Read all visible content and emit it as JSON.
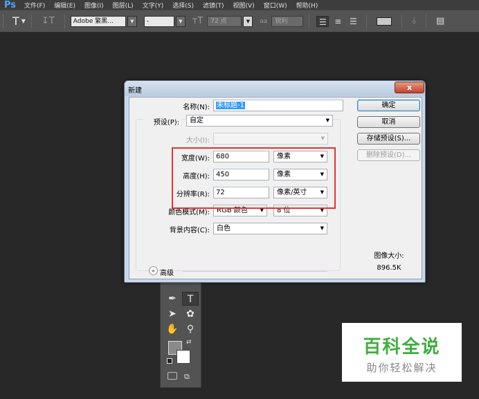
{
  "app": {
    "logo": "Ps"
  },
  "menu": [
    "文件(F)",
    "编辑(E)",
    "图像(I)",
    "图层(L)",
    "文字(Y)",
    "选择(S)",
    "滤镜(T)",
    "视图(V)",
    "窗口(W)",
    "帮助(H)"
  ],
  "options": {
    "tool_icon": "T",
    "font_family": "Adobe 繁黑...",
    "font_style": "-",
    "font_size": "72 点",
    "antialias_icon": "aa",
    "antialias": "锐利"
  },
  "dialog": {
    "title": "新建",
    "close": "x",
    "name_label": "名称(N):",
    "name_value": "未标题-1",
    "preset_label": "预设(P):",
    "preset_value": "自定",
    "size_label": "大小(I):",
    "width_label": "宽度(W):",
    "width_value": "680",
    "width_unit": "像素",
    "height_label": "高度(H):",
    "height_value": "450",
    "height_unit": "像素",
    "res_label": "分辨率(R):",
    "res_value": "72",
    "res_unit": "像素/英寸",
    "color_mode_label": "颜色模式(M):",
    "color_mode_value": "RGB 颜色",
    "bit_depth": "8 位",
    "bg_label": "背景内容(C):",
    "bg_value": "白色",
    "advanced": "高级",
    "buttons": {
      "ok": "确定",
      "cancel": "取消",
      "save_preset": "存储预设(S)...",
      "delete_preset": "删除预设(D)..."
    },
    "image_size_label": "图像大小:",
    "image_size_value": "896.5K"
  },
  "watermark": {
    "title": "百科全说",
    "subtitle": "助你轻松解决"
  }
}
